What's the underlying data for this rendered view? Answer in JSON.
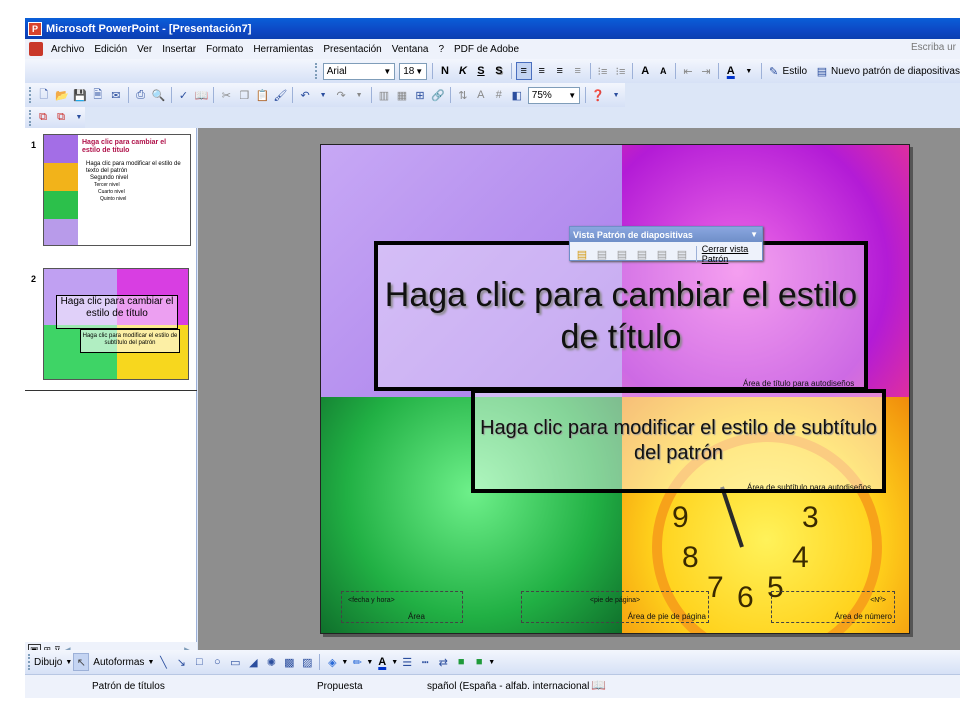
{
  "window": {
    "title": "Microsoft PowerPoint - [Presentación7]"
  },
  "menu": {
    "items": [
      "Archivo",
      "Edición",
      "Ver",
      "Insertar",
      "Formato",
      "Herramientas",
      "Presentación",
      "Ventana",
      "?",
      "PDF de Adobe"
    ],
    "ask_placeholder": "Escriba ur"
  },
  "format_toolbar": {
    "font": "Arial",
    "size": "18",
    "bold": "N",
    "italic": "K",
    "underline": "S",
    "shadow": "S",
    "grow_font": "A",
    "shrink_font": "A",
    "font_color": "A",
    "style_label": "Estilo",
    "new_master_label": "Nuevo patrón de diapositivas"
  },
  "standard_toolbar": {
    "zoom": "75%"
  },
  "slides_panel": {
    "thumb1": {
      "number": "1",
      "title": "Haga clic para cambiar el estilo de título",
      "bullet1": "Haga clic para modificar el estilo de texto del patrón",
      "bullet2": "Segundo nivel",
      "bullet3": "Tercer nivel",
      "bullet4": "Cuarto nivel",
      "bullet5": "Quinto nivel"
    },
    "thumb2": {
      "number": "2",
      "title": "Haga clic para cambiar el estilo de título",
      "subtitle": "Haga clic para modificar el estilo de subtítulo del patrón"
    }
  },
  "slide": {
    "title": "Haga clic para cambiar el estilo de título",
    "subtitle": "Haga clic para modificar el estilo de subtítulo del patrón",
    "title_area_label": "Área de título para autodiseños",
    "subtitle_area_label": "Área de subtítulo para autodiseños",
    "footer": {
      "date_text": "<fecha y hora>",
      "date_area": "Área",
      "footer_text": "<pie de página>",
      "footer_area": "Área de pie de página",
      "number_text": "<Nº>",
      "number_area": "Área de número"
    }
  },
  "floating_toolbar": {
    "title": "Vista Patrón de diapositivas",
    "close_label": "Cerrar vista Patrón"
  },
  "drawing_toolbar": {
    "draw_label": "Dibujo",
    "autoshapes_label": "Autoformas"
  },
  "status": {
    "design": "Patrón de títulos",
    "template": "Propuesta",
    "language": "spañol (España - alfab. internacional"
  },
  "colors": {
    "titlebar": "#0d47c4",
    "accent": "#2b4e9e"
  }
}
